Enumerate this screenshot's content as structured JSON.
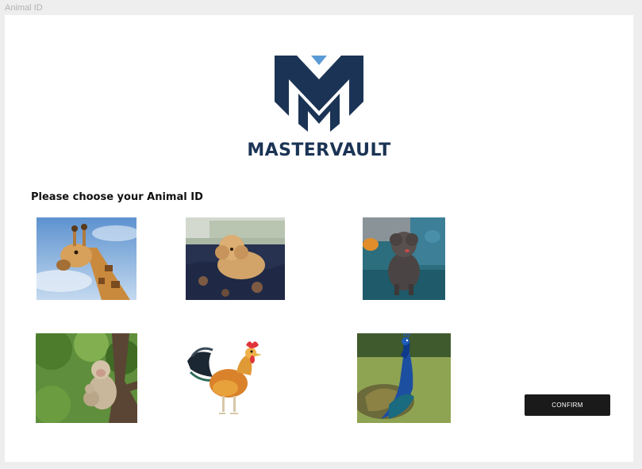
{
  "window": {
    "title": "Animal ID"
  },
  "brand": {
    "name": "MASTERVAULT",
    "logo_icon": "mastervault-m-logo-icon",
    "color": "#1b3455",
    "accent": "#5b9bd5"
  },
  "prompt": "Please choose your Animal ID",
  "animals": [
    {
      "name": "giraffe",
      "icon": "giraffe-photo"
    },
    {
      "name": "poodle",
      "icon": "apricot-poodle-photo"
    },
    {
      "name": "poodle",
      "icon": "grey-poodle-photo"
    },
    {
      "name": "monkey",
      "icon": "monkey-photo"
    },
    {
      "name": "rooster",
      "icon": "rooster-photo"
    },
    {
      "name": "peacock",
      "icon": "peacock-photo"
    }
  ],
  "confirm_label": "CONFIRM"
}
